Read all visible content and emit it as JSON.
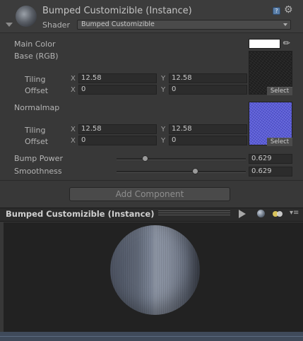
{
  "header": {
    "title": "Bumped Customizible (Instance)",
    "shader_label": "Shader",
    "shader_value": "Bumped Customizible",
    "help_glyph": "?",
    "gear_glyph": "⚙"
  },
  "properties": {
    "main_color_label": "Main Color",
    "main_color_value": "#ffffff",
    "base_label": "Base (RGB)",
    "base_tiling_label": "Tiling",
    "base_tiling_x": "12.58",
    "base_tiling_y": "12.58",
    "base_offset_label": "Offset",
    "base_offset_x": "0",
    "base_offset_y": "0",
    "normal_label": "Normalmap",
    "normal_tiling_label": "Tiling",
    "normal_tiling_x": "12.58",
    "normal_tiling_y": "12.58",
    "normal_offset_label": "Offset",
    "normal_offset_x": "0",
    "normal_offset_y": "0",
    "axis_x": "X",
    "axis_y": "Y",
    "select_label": "Select",
    "bump_power_label": "Bump Power",
    "bump_power_value": "0.629",
    "smoothness_label": "Smoothness",
    "smoothness_value": "0.629",
    "bump_power_slider_fraction": 0.22,
    "smoothness_slider_fraction": 0.61
  },
  "add_component_label": "Add Component",
  "preview": {
    "title": "Bumped Customizible (Instance)",
    "menu_glyph": "▾≡"
  },
  "colors": {
    "panel_bg": "#383838",
    "normal_texture": "#5a5cd6",
    "footer_strip": "#3f4a5a"
  }
}
